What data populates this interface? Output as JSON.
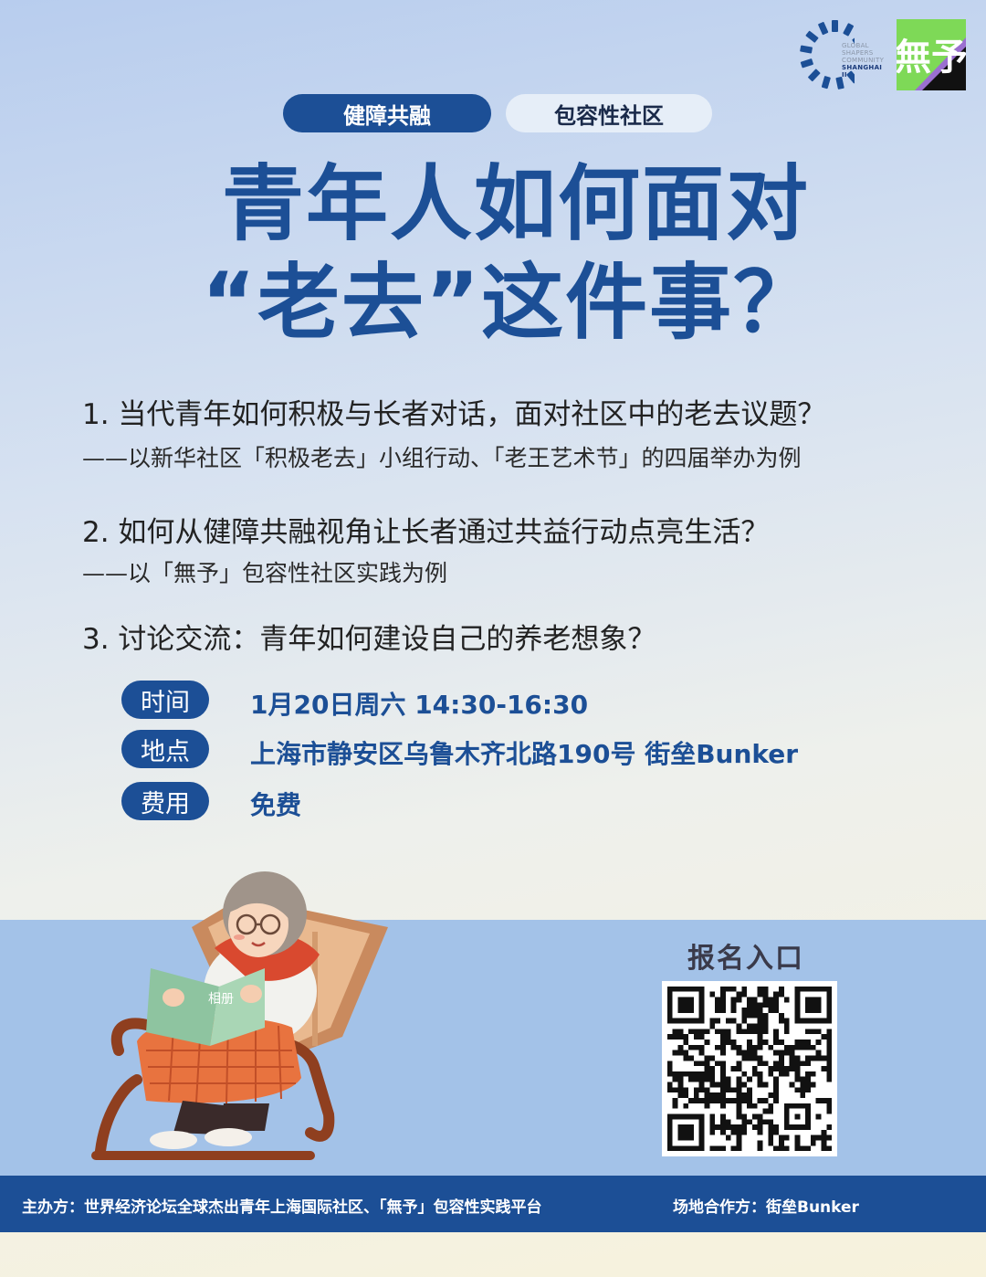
{
  "logos": {
    "gs_text": [
      "GLOBAL",
      "SHAPERS",
      "COMMUNITY"
    ],
    "gs_hub": "SHANGHAI II",
    "wuyu_mark": "無予"
  },
  "tags": [
    "健障共融",
    "包容性社区"
  ],
  "title": [
    "青年人如何面对",
    "“老去”这件事？"
  ],
  "questions": [
    {
      "main": "1. 当代青年如何积极与长者对话，面对社区中的老去议题？",
      "sub": "——以新华社区「积极老去」小组行动、「老王艺术节」的四届举办为例"
    },
    {
      "main": "2. 如何从健障共融视角让长者通过共益行动点亮生活？",
      "sub": "——以「無予」包容性社区实践为例"
    },
    {
      "main": "3. 讨论交流：青年如何建设自己的养老想象？",
      "sub": ""
    }
  ],
  "info": [
    {
      "label": "时间",
      "value": "1月20日周六 14:30-16:30"
    },
    {
      "label": "地点",
      "value": "上海市静安区乌鲁木齐北路190号 街垒Bunker"
    },
    {
      "label": "费用",
      "value": "免费"
    }
  ],
  "illustration": {
    "book_label": "相册"
  },
  "registration": {
    "title": "报名入口"
  },
  "footer": {
    "organizer": "主办方：世界经济论坛全球杰出青年上海国际社区、「無予」包容性实践平台",
    "venue_partner": "场地合作方：街垒Bunker"
  },
  "colors": {
    "brand_blue": "#1c4f96",
    "band_blue": "#a3c2e8",
    "wuyu_green": "#7ed957",
    "wuyu_purple": "#9b6fd0"
  }
}
